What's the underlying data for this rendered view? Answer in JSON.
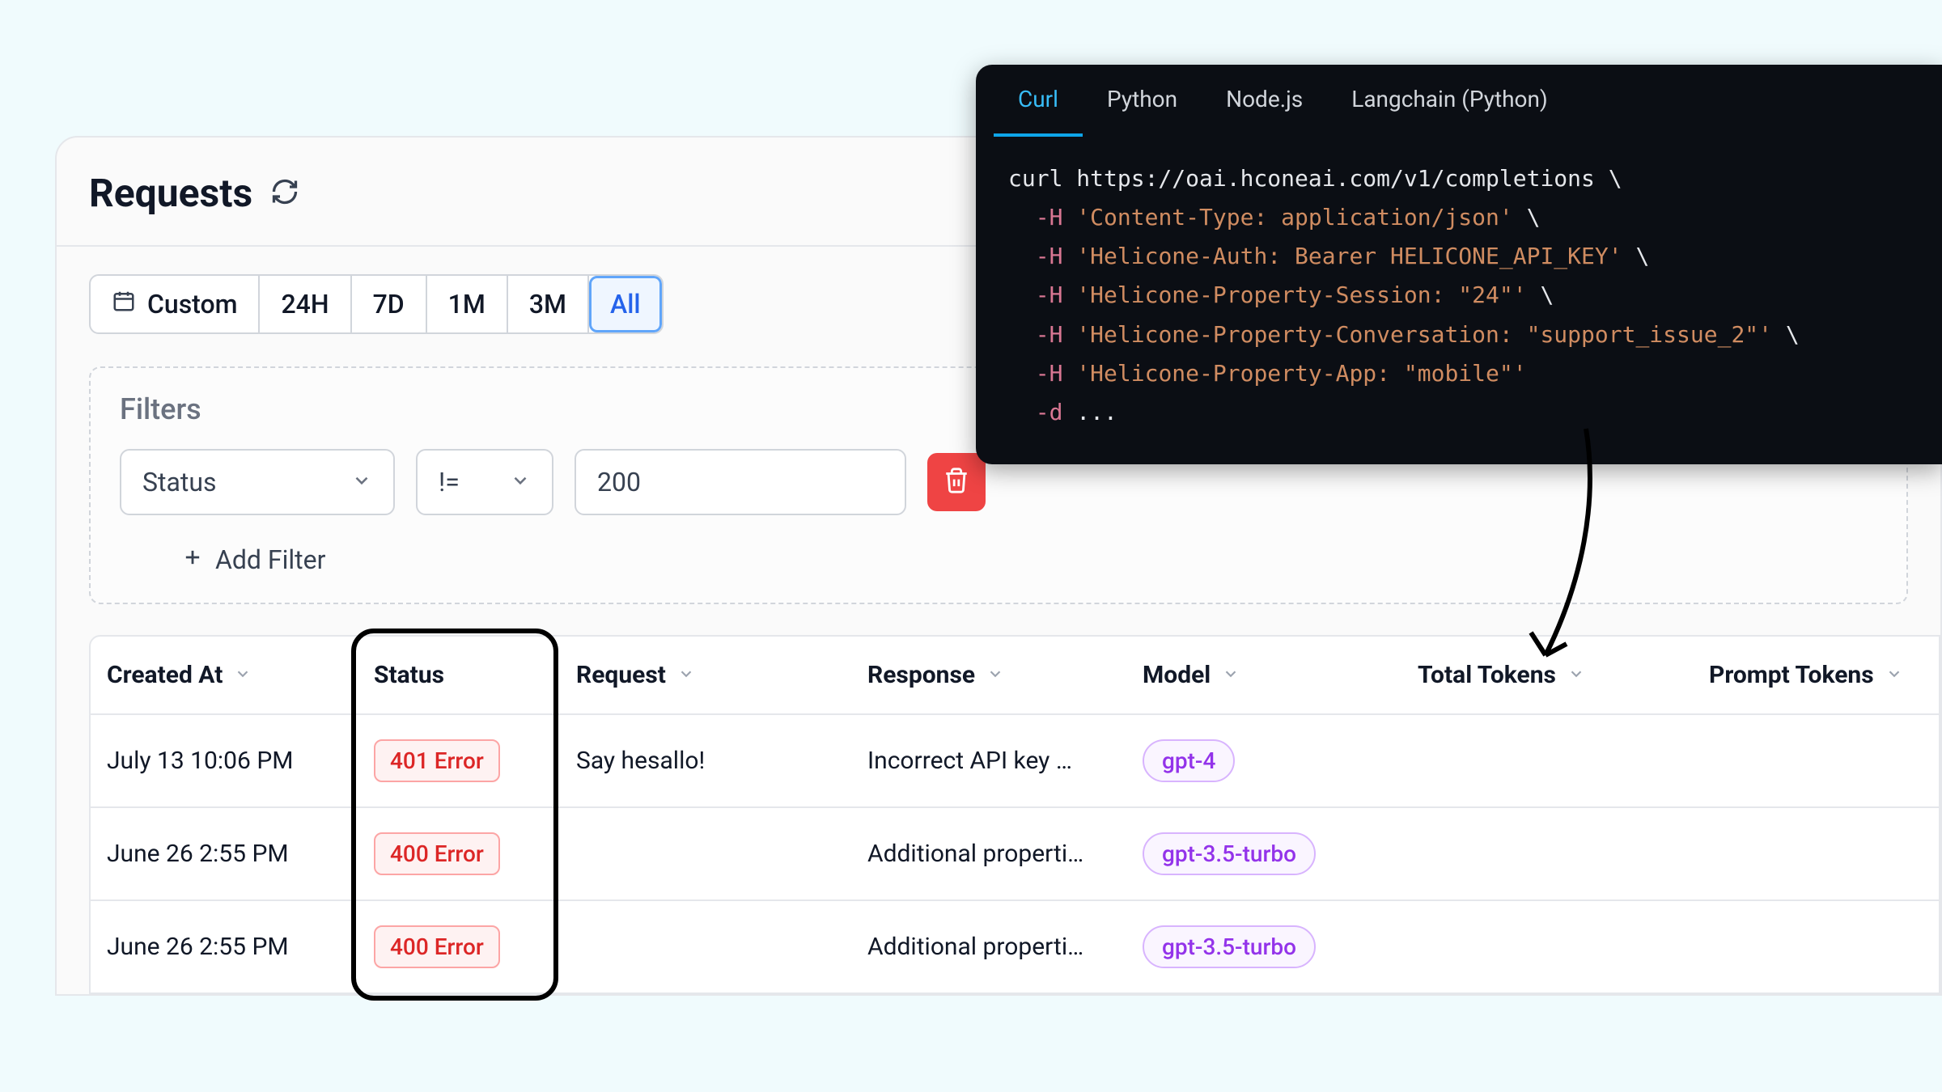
{
  "header": {
    "title": "Requests"
  },
  "time_range": {
    "buttons": [
      "Custom",
      "24H",
      "7D",
      "1M",
      "3M",
      "All"
    ],
    "active_index": 5
  },
  "filters": {
    "label": "Filters",
    "row": {
      "field": "Status",
      "operator": "!=",
      "value": "200"
    },
    "add_label": "Add Filter"
  },
  "table": {
    "columns": [
      "Created At",
      "Status",
      "Request",
      "Response",
      "Model",
      "Total Tokens",
      "Prompt Tokens"
    ],
    "rows": [
      {
        "created_at": "July 13 10:06 PM",
        "status": "401 Error",
        "request": "Say hesallo!",
        "response": "Incorrect API key …",
        "model": "gpt-4"
      },
      {
        "created_at": "June 26 2:55 PM",
        "status": "400 Error",
        "request": "",
        "response": "Additional properti…",
        "model": "gpt-3.5-turbo"
      },
      {
        "created_at": "June 26 2:55 PM",
        "status": "400 Error",
        "request": "",
        "response": "Additional properti…",
        "model": "gpt-3.5-turbo"
      }
    ]
  },
  "code": {
    "tabs": [
      "Curl",
      "Python",
      "Node.js",
      "Langchain (Python)"
    ],
    "active_tab": 0,
    "lines": [
      [
        {
          "t": "plain",
          "v": "curl https://oai.hconeai.com/v1/completions \\"
        }
      ],
      [
        {
          "t": "plain",
          "v": "  "
        },
        {
          "t": "flag",
          "v": "-H"
        },
        {
          "t": "plain",
          "v": " "
        },
        {
          "t": "str",
          "v": "'Content-Type: application/json'"
        },
        {
          "t": "plain",
          "v": " \\"
        }
      ],
      [
        {
          "t": "plain",
          "v": "  "
        },
        {
          "t": "flag",
          "v": "-H"
        },
        {
          "t": "plain",
          "v": " "
        },
        {
          "t": "str",
          "v": "'Helicone-Auth: Bearer HELICONE_API_KEY'"
        },
        {
          "t": "plain",
          "v": " \\"
        }
      ],
      [
        {
          "t": "plain",
          "v": "  "
        },
        {
          "t": "flag",
          "v": "-H"
        },
        {
          "t": "plain",
          "v": " "
        },
        {
          "t": "str",
          "v": "'Helicone-Property-Session: \"24\"'"
        },
        {
          "t": "plain",
          "v": " \\"
        }
      ],
      [
        {
          "t": "plain",
          "v": "  "
        },
        {
          "t": "flag",
          "v": "-H"
        },
        {
          "t": "plain",
          "v": " "
        },
        {
          "t": "str",
          "v": "'Helicone-Property-Conversation: \"support_issue_2\"'"
        },
        {
          "t": "plain",
          "v": " \\"
        }
      ],
      [
        {
          "t": "plain",
          "v": "  "
        },
        {
          "t": "flag",
          "v": "-H"
        },
        {
          "t": "plain",
          "v": " "
        },
        {
          "t": "str",
          "v": "'Helicone-Property-App: \"mobile\"'"
        }
      ],
      [
        {
          "t": "plain",
          "v": "  "
        },
        {
          "t": "flag",
          "v": "-d"
        },
        {
          "t": "plain",
          "v": " ..."
        }
      ]
    ]
  }
}
